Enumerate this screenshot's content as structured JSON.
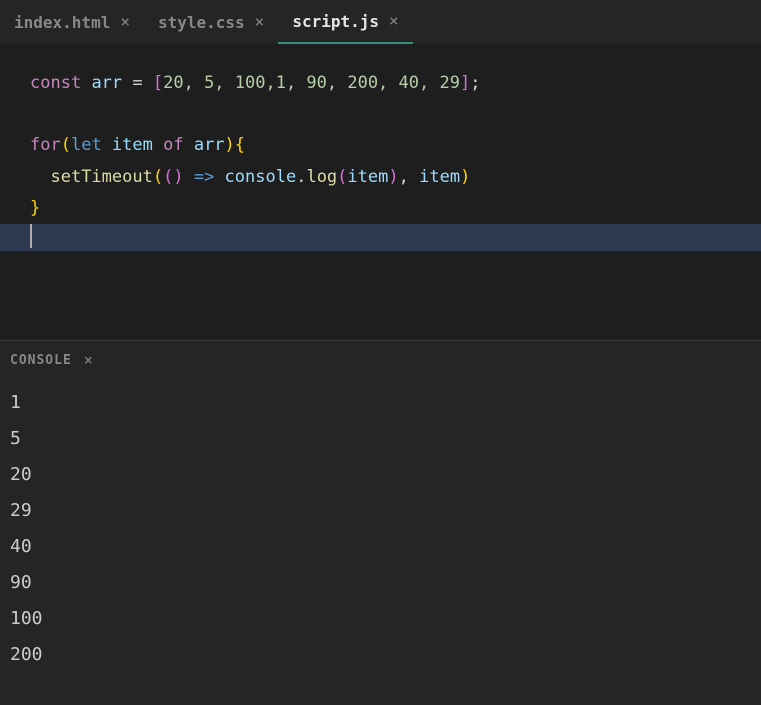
{
  "tabs": [
    {
      "name": "index.html",
      "active": false
    },
    {
      "name": "style.css",
      "active": false
    },
    {
      "name": "script.js",
      "active": true
    }
  ],
  "code": {
    "line1": {
      "const": "const",
      "arr": "arr",
      "eq": " = ",
      "lbracket": "[",
      "values": "20, 5, 100,1, 90, 200, 40, 29",
      "rbracket": "]",
      "semi": ";"
    },
    "line3": {
      "for": "for",
      "lparen": "(",
      "let": "let",
      "item": " item ",
      "of": "of",
      "arr": " arr",
      "rparen": ")",
      "lbrace": "{"
    },
    "line4": {
      "indent": "  ",
      "setTimeout": "setTimeout",
      "lparen1": "(",
      "lparen2": "(",
      "rparen2": ")",
      "arrow": " => ",
      "console": "console",
      "dot": ".",
      "log": "log",
      "lparen3": "(",
      "item1": "item",
      "rparen3": ")",
      "comma": ", ",
      "item2": "item",
      "rparen1": ")"
    },
    "line5": {
      "rbrace": "}"
    }
  },
  "console": {
    "title": "CONSOLE",
    "output": [
      "1",
      "5",
      "20",
      "29",
      "40",
      "90",
      "100",
      "200"
    ]
  }
}
